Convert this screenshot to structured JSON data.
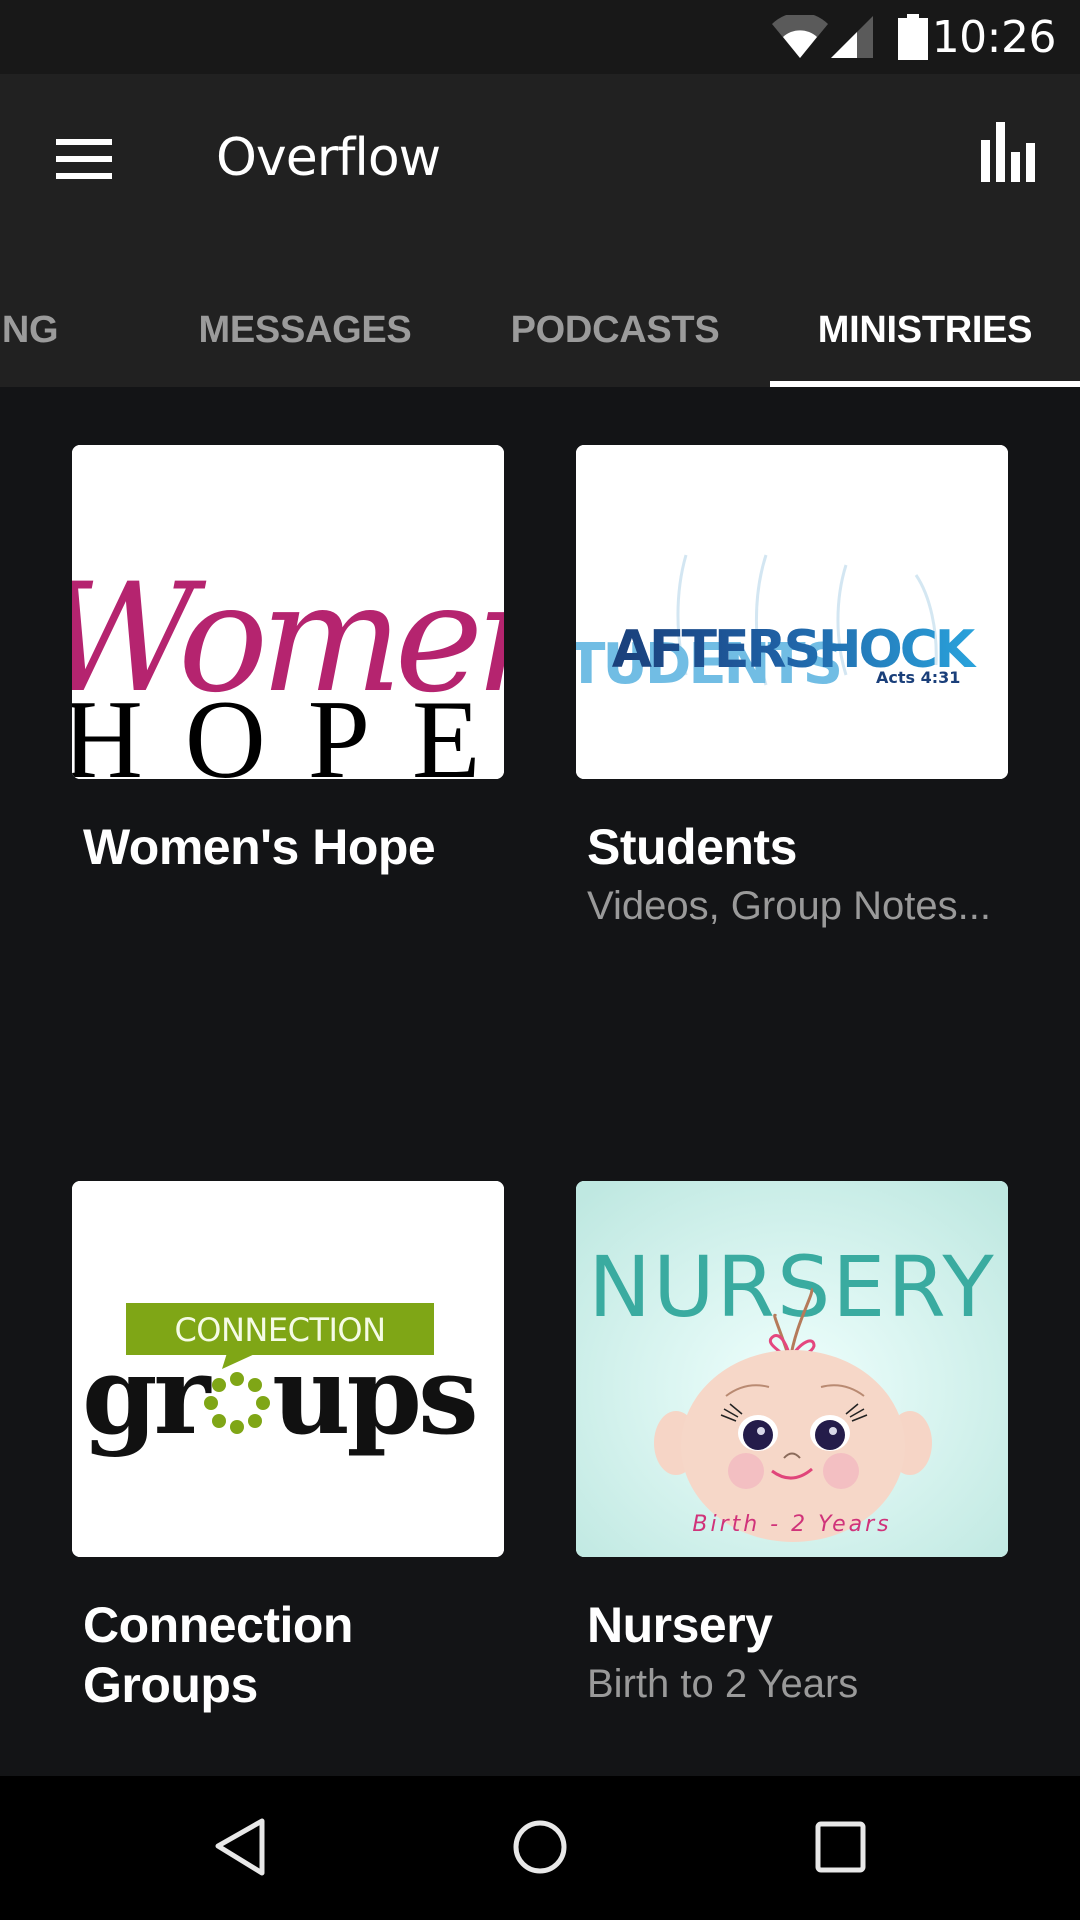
{
  "status_bar": {
    "time": "10:26",
    "icons": [
      "wifi-icon",
      "cell-signal-icon",
      "battery-icon"
    ]
  },
  "app_bar": {
    "menu_icon": "hamburger-menu-icon",
    "title": "Overflow",
    "action_icon": "bar-chart-icon"
  },
  "tabs": [
    {
      "label": "ING",
      "active": false
    },
    {
      "label": "MESSAGES",
      "active": false
    },
    {
      "label": "PODCASTS",
      "active": false
    },
    {
      "label": "MINISTRIES",
      "active": true
    }
  ],
  "ministries": [
    {
      "title": "Women's Hope",
      "subtitle": "",
      "art": {
        "script_text": "Women",
        "serif_text": "HOPE",
        "accent": "#b5246f"
      }
    },
    {
      "title": "Students",
      "subtitle": "Videos, Group Notes...",
      "art": {
        "main_text": "AFTERSHOCK",
        "sub_text": "STUDENTS",
        "verse": "Acts 4:31",
        "accent_dark": "#1a3f7a",
        "accent_light": "#2aa3dc"
      }
    },
    {
      "title": "Connection Groups",
      "title_lines": [
        "Connection",
        "Groups"
      ],
      "subtitle": "",
      "art": {
        "banner_text": "CONNECTION",
        "word_start": "gr",
        "word_end": "ups",
        "accent": "#7fa616"
      }
    },
    {
      "title": "Nursery",
      "subtitle": "Birth to 2 Years",
      "art": {
        "heading": "NURSERY",
        "caption": "Birth - 2 Years",
        "accent": "#3aaba0",
        "caption_color": "#d0337a"
      }
    }
  ],
  "nav_bar": {
    "back_icon": "back-triangle-icon",
    "home_icon": "home-circle-icon",
    "recents_icon": "recents-square-icon"
  }
}
